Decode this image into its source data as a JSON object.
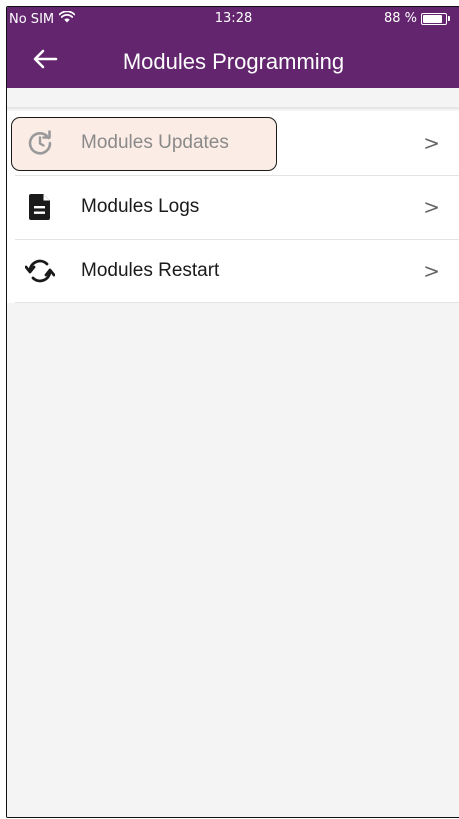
{
  "status_bar": {
    "carrier": "No SIM",
    "time": "13:28",
    "battery_percent": "88 %",
    "battery_level": 0.88
  },
  "header": {
    "title": "Modules Programming",
    "back_icon": "arrow-left-icon",
    "background_color": "#63256e"
  },
  "menu": {
    "items": [
      {
        "label": "Modules Updates",
        "icon": "update-clock-icon",
        "chevron": ">",
        "highlighted": true
      },
      {
        "label": "Modules Logs",
        "icon": "document-icon",
        "chevron": ">"
      },
      {
        "label": "Modules Restart",
        "icon": "restart-icon",
        "chevron": ">"
      }
    ]
  },
  "colors": {
    "highlight_fill": "#fbece6",
    "highlight_border": "#1a1a1a"
  }
}
